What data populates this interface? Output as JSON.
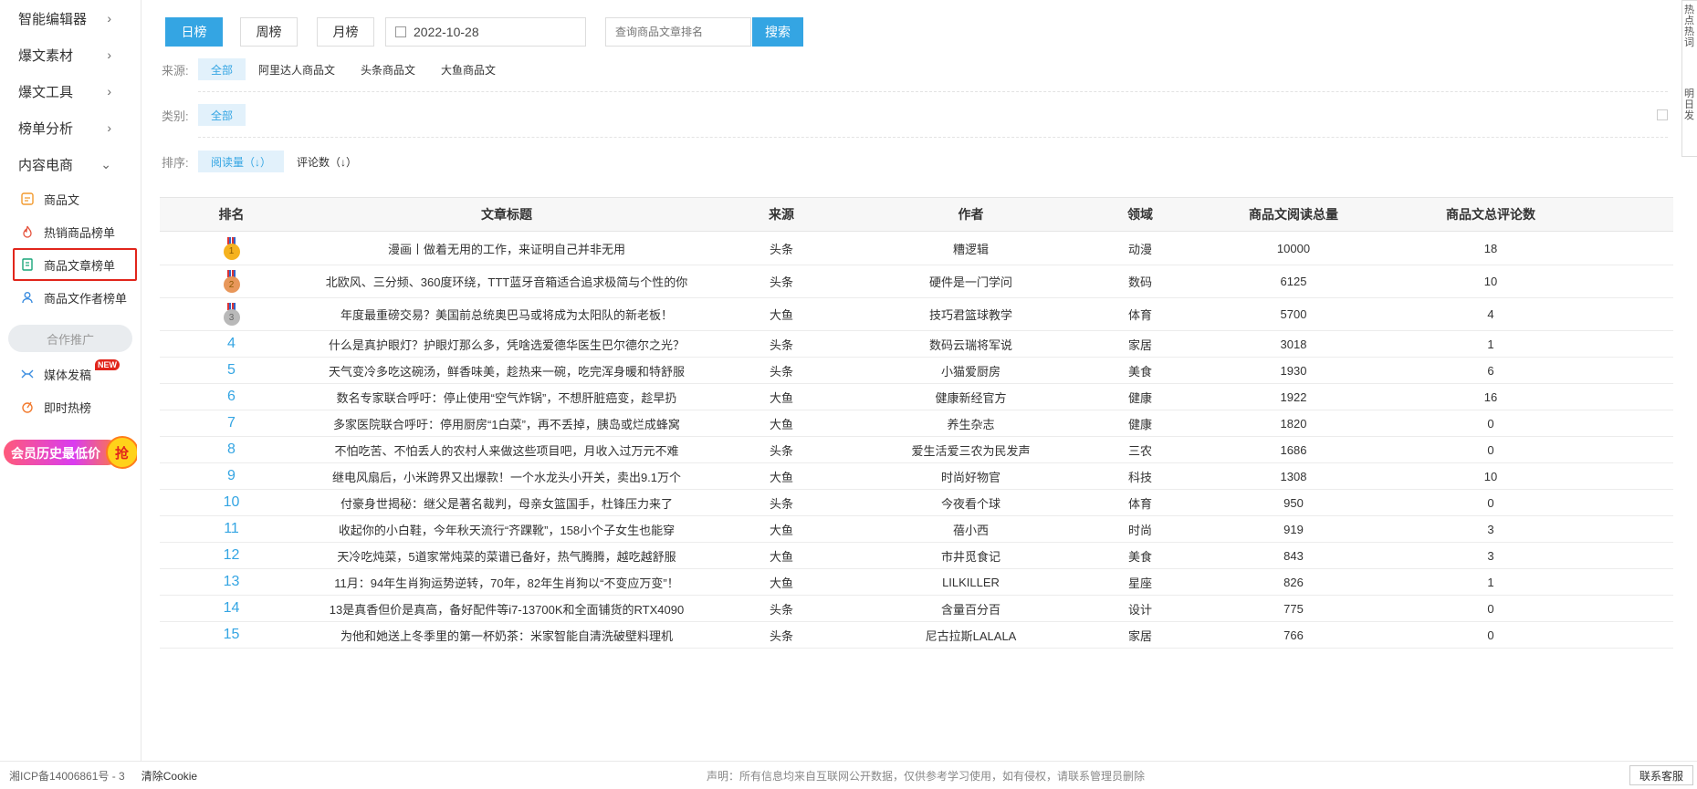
{
  "sidebar": {
    "menus": [
      {
        "label": "智能编辑器",
        "icon": "chevron-right-icon"
      },
      {
        "label": "爆文素材",
        "icon": "chevron-right-icon"
      },
      {
        "label": "爆文工具",
        "icon": "chevron-right-icon"
      },
      {
        "label": "榜单分析",
        "icon": "chevron-right-icon"
      },
      {
        "label": "内容电商",
        "icon": "chevron-down-icon"
      }
    ],
    "subitems": [
      {
        "label": "商品文",
        "icon": "article-icon"
      },
      {
        "label": "热销商品榜单",
        "icon": "flame-icon"
      },
      {
        "label": "商品文章榜单",
        "icon": "document-icon",
        "active": true
      },
      {
        "label": "商品文作者榜单",
        "icon": "user-icon"
      }
    ],
    "coop_label": "合作推广",
    "extras": [
      {
        "label": "媒体发稿",
        "icon": "media-icon",
        "badge": "NEW"
      },
      {
        "label": "即时热榜",
        "icon": "hot-icon"
      }
    ],
    "vip_banner_text": "会员历史最低价",
    "vip_banner_badge": "抢"
  },
  "toolbar": {
    "tabs": [
      "日榜",
      "周榜",
      "月榜"
    ],
    "active_tab": 0,
    "date_value": "2022-10-28",
    "search_placeholder": "查询商品文章排名",
    "search_button": "搜索"
  },
  "filters": {
    "source_label": "来源:",
    "source_options": [
      "全部",
      "阿里达人商品文",
      "头条商品文",
      "大鱼商品文"
    ],
    "category_label": "类别:",
    "category_options": [
      "全部"
    ],
    "sort_label": "排序:",
    "sort_options": [
      "阅读量（↓）",
      "评论数（↓）"
    ]
  },
  "table": {
    "headers": [
      "排名",
      "文章标题",
      "来源",
      "作者",
      "领域",
      "商品文阅读总量",
      "商品文总评论数"
    ],
    "rows": [
      {
        "rank": "1",
        "title": "漫画丨做着无用的工作，来证明自己并非无用",
        "source": "头条",
        "author": "糟逻辑",
        "field": "动漫",
        "reads": "10000",
        "comments": "18"
      },
      {
        "rank": "2",
        "title": "北欧风、三分频、360度环绕，TTT蓝牙音箱适合追求极简与个性的你",
        "source": "头条",
        "author": "硬件是一门学问",
        "field": "数码",
        "reads": "6125",
        "comments": "10"
      },
      {
        "rank": "3",
        "title": "年度最重磅交易？美国前总统奥巴马或将成为太阳队的新老板！",
        "source": "大鱼",
        "author": "技巧君篮球教学",
        "field": "体育",
        "reads": "5700",
        "comments": "4"
      },
      {
        "rank": "4",
        "title": "什么是真护眼灯？护眼灯那么多，凭啥选爱德华医生巴尔德尔之光？",
        "source": "头条",
        "author": "数码云瑞将军说",
        "field": "家居",
        "reads": "3018",
        "comments": "1"
      },
      {
        "rank": "5",
        "title": "天气变冷多吃这碗汤，鲜香味美，趁热来一碗，吃完浑身暖和特舒服",
        "source": "头条",
        "author": "小猫爱厨房",
        "field": "美食",
        "reads": "1930",
        "comments": "6"
      },
      {
        "rank": "6",
        "title": "数名专家联合呼吁：停止使用“空气炸锅”，不想肝脏癌变，趁早扔",
        "source": "大鱼",
        "author": "健康新经官方",
        "field": "健康",
        "reads": "1922",
        "comments": "16"
      },
      {
        "rank": "7",
        "title": "多家医院联合呼吁：停用厨房“1白菜”，再不丢掉，胰岛或烂成蜂窝",
        "source": "大鱼",
        "author": "养生杂志",
        "field": "健康",
        "reads": "1820",
        "comments": "0"
      },
      {
        "rank": "8",
        "title": "不怕吃苦、不怕丢人的农村人来做这些项目吧，月收入过万元不难",
        "source": "头条",
        "author": "爱生活爱三农为民发声",
        "field": "三农",
        "reads": "1686",
        "comments": "0"
      },
      {
        "rank": "9",
        "title": "继电风扇后，小米跨界又出爆款！一个水龙头小开关，卖出9.1万个",
        "source": "大鱼",
        "author": "时尚好物官",
        "field": "科技",
        "reads": "1308",
        "comments": "10"
      },
      {
        "rank": "10",
        "title": "付豪身世揭秘：继父是著名裁判，母亲女篮国手，杜锋压力来了",
        "source": "头条",
        "author": "今夜看个球",
        "field": "体育",
        "reads": "950",
        "comments": "0"
      },
      {
        "rank": "11",
        "title": "收起你的小白鞋，今年秋天流行“齐踝靴”，158小个子女生也能穿",
        "source": "大鱼",
        "author": "蓓小西",
        "field": "时尚",
        "reads": "919",
        "comments": "3"
      },
      {
        "rank": "12",
        "title": "天冷吃炖菜，5道家常炖菜的菜谱已备好，热气腾腾，越吃越舒服",
        "source": "大鱼",
        "author": "市井觅食记",
        "field": "美食",
        "reads": "843",
        "comments": "3"
      },
      {
        "rank": "13",
        "title": "11月：94年生肖狗运势逆转，70年，82年生肖狗以“不变应万变”！",
        "source": "大鱼",
        "author": "LILKILLER",
        "field": "星座",
        "reads": "826",
        "comments": "1"
      },
      {
        "rank": "14",
        "title": "13是真香但价是真高，备好配件等i7-13700K和全面铺货的RTX4090",
        "source": "头条",
        "author": "含量百分百",
        "field": "设计",
        "reads": "775",
        "comments": "0"
      },
      {
        "rank": "15",
        "title": "为他和她送上冬季里的第一杯奶茶：米家智能自清洗破壁料理机",
        "source": "头条",
        "author": "尼古拉斯LALALA",
        "field": "家居",
        "reads": "766",
        "comments": "0"
      }
    ]
  },
  "footer": {
    "icp": "湘ICP备14006861号 - 3",
    "clear_cookie": "清除Cookie",
    "disclaimer": "声明：所有信息均来自互联网公开数据，仅供参考学习使用，如有侵权，请联系管理员删除",
    "contact": "联系客服"
  },
  "right_widget": {
    "text1": "热点热词",
    "text2": "明日发"
  },
  "colors": {
    "accent": "#34a5e3",
    "active_outline": "#e1251b",
    "gold": "#f5b21f",
    "silver": "#e8975a",
    "bronze": "#b9b9b9"
  }
}
